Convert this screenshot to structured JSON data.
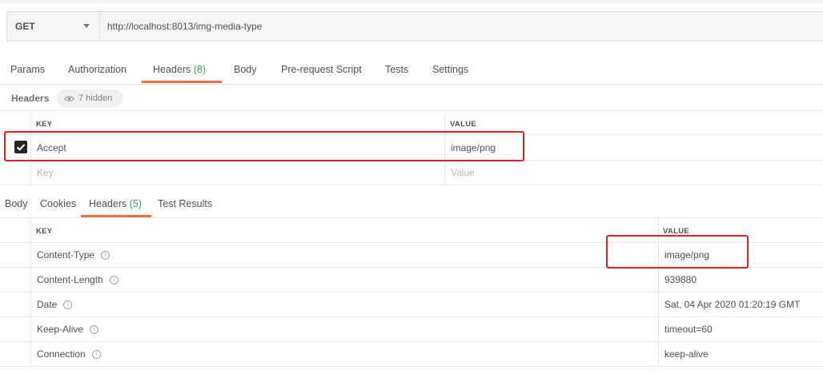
{
  "request": {
    "method": "GET",
    "url": "http://localhost:8013/img-media-type"
  },
  "request_tabs": [
    {
      "label": "Params",
      "count": ""
    },
    {
      "label": "Authorization",
      "count": ""
    },
    {
      "label": "Headers",
      "count": "(8)"
    },
    {
      "label": "Body",
      "count": ""
    },
    {
      "label": "Pre-request Script",
      "count": ""
    },
    {
      "label": "Tests",
      "count": ""
    },
    {
      "label": "Settings",
      "count": ""
    }
  ],
  "headers_section": {
    "title": "Headers",
    "hidden_label": "7 hidden",
    "col_key": "KEY",
    "col_value": "VALUE",
    "rows": [
      {
        "key": "Accept",
        "value": "image/png",
        "checked": true
      }
    ],
    "key_placeholder": "Key",
    "value_placeholder": "Value"
  },
  "response_tabs": [
    {
      "label": "Body",
      "count": ""
    },
    {
      "label": "Cookies",
      "count": ""
    },
    {
      "label": "Headers",
      "count": "(5)"
    },
    {
      "label": "Test Results",
      "count": ""
    }
  ],
  "response_headers": {
    "col_key": "KEY",
    "col_value": "VALUE",
    "rows": [
      {
        "key": "Content-Type",
        "value": "image/png"
      },
      {
        "key": "Content-Length",
        "value": "939880"
      },
      {
        "key": "Date",
        "value": "Sat, 04 Apr 2020 01:20:19 GMT"
      },
      {
        "key": "Keep-Alive",
        "value": "timeout=60"
      },
      {
        "key": "Connection",
        "value": "keep-alive"
      }
    ]
  },
  "colors": {
    "accent": "#f26b3a",
    "count": "#26a65b",
    "highlight": "#e32020"
  },
  "icons": {
    "method_dropdown": "caret-down-icon",
    "hidden_toggle": "eye-icon",
    "header_info": "info-icon",
    "checkbox": "check-icon"
  }
}
